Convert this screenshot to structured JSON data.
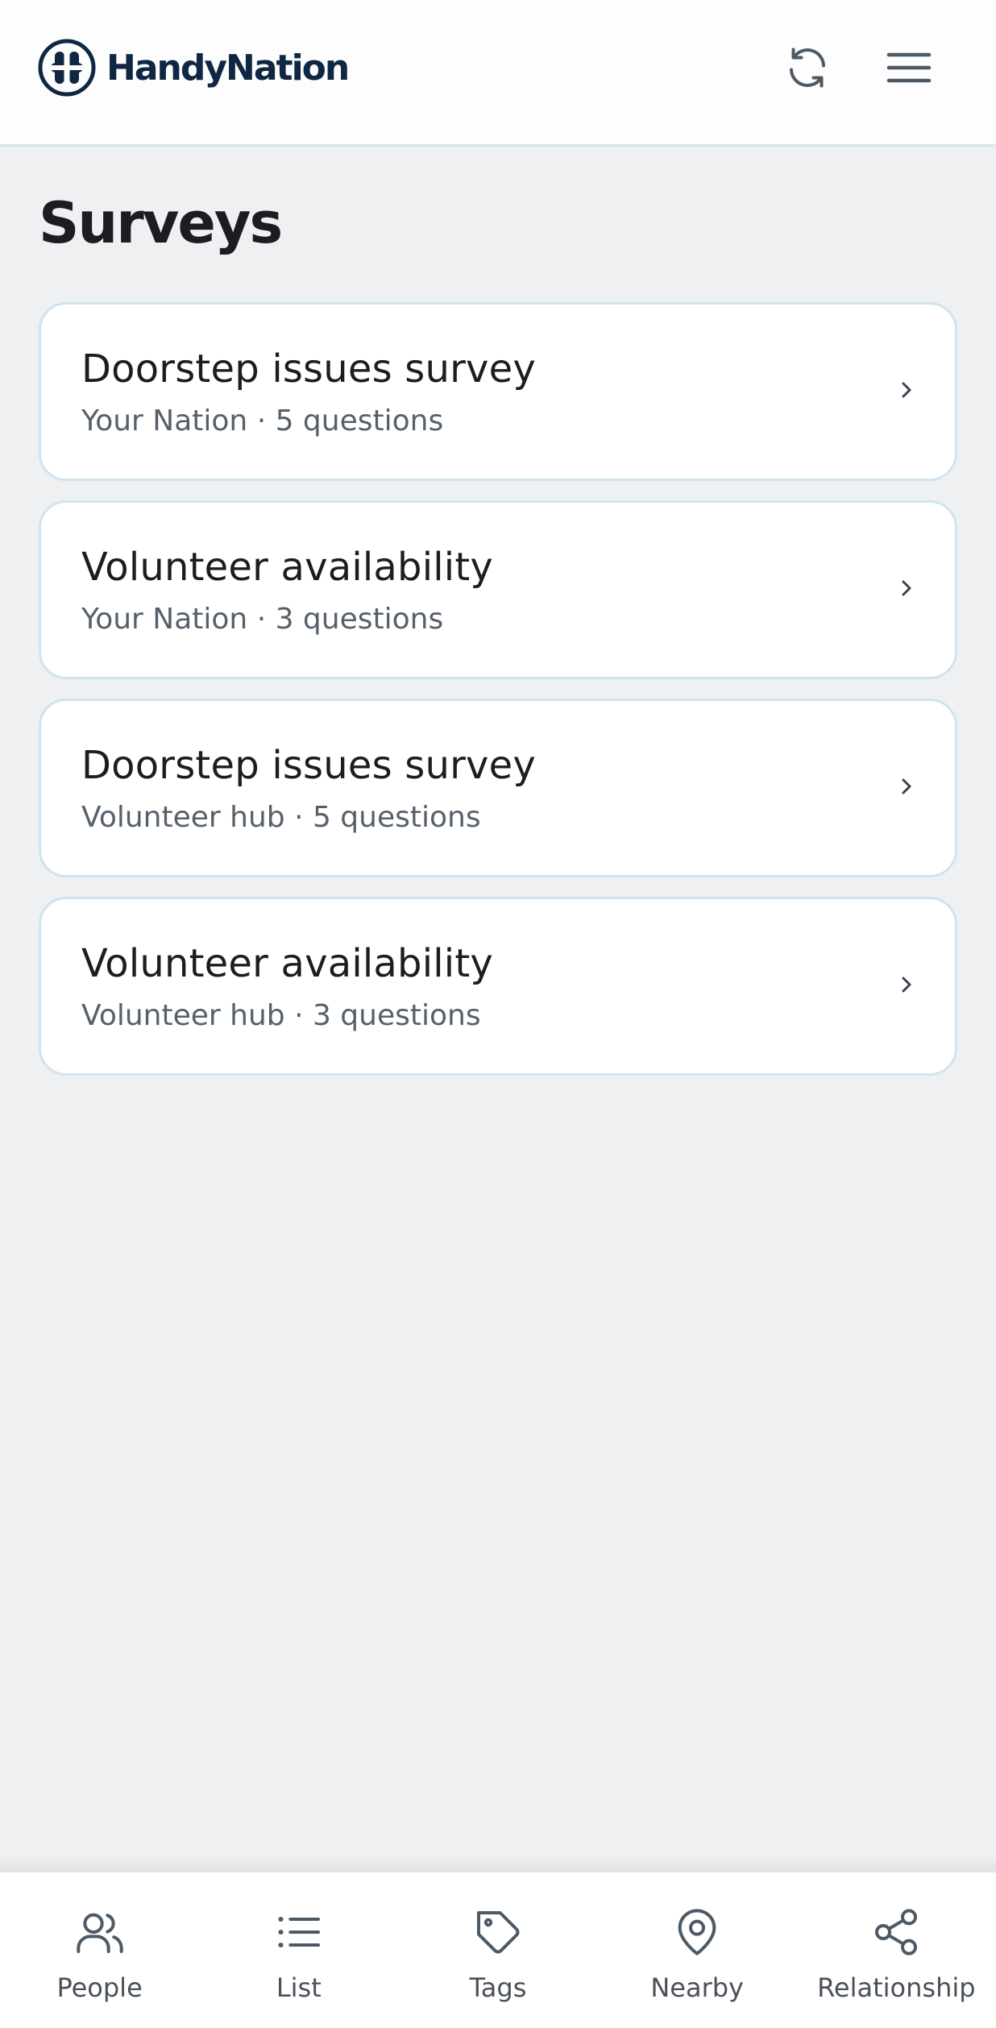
{
  "header": {
    "brand": "HandyNation",
    "icons": {
      "logo": "handynation-logo-icon",
      "refresh": "refresh-icon",
      "menu": "hamburger-menu-icon"
    }
  },
  "page": {
    "title": "Surveys"
  },
  "surveys": [
    {
      "title": "Doorstep issues survey",
      "subtitle": "Your Nation · 5 questions"
    },
    {
      "title": "Volunteer availability",
      "subtitle": "Your Nation · 3 questions"
    },
    {
      "title": "Doorstep issues survey",
      "subtitle": "Volunteer hub · 5 questions"
    },
    {
      "title": "Volunteer availability",
      "subtitle": "Volunteer hub · 3 questions"
    }
  ],
  "tabbar": {
    "tabs": [
      {
        "label": "People",
        "icon": "people-icon"
      },
      {
        "label": "List",
        "icon": "list-icon"
      },
      {
        "label": "Tags",
        "icon": "tag-icon"
      },
      {
        "label": "Nearby",
        "icon": "location-pin-icon"
      },
      {
        "label": "Relationship",
        "icon": "share-network-icon"
      }
    ]
  },
  "colors": {
    "background": "#eef0f2",
    "brand": "#0f2742",
    "card_border": "#cfe4ee",
    "text_primary": "#1b1d21",
    "text_secondary": "#56606b"
  }
}
